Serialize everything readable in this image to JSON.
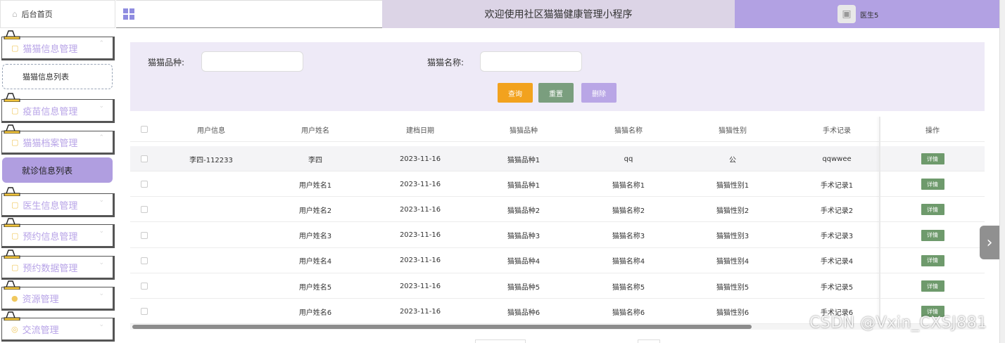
{
  "sidebar": {
    "home_label": "后台首页",
    "menus": [
      {
        "label": "猫猫信息管理"
      },
      {
        "label": "疫苗信息管理"
      },
      {
        "label": "猫猫档案管理"
      },
      {
        "label": "医生信息管理"
      },
      {
        "label": "预约信息管理"
      },
      {
        "label": "预约数据管理"
      },
      {
        "label": "资源管理"
      },
      {
        "label": "交流管理"
      }
    ],
    "sub_cat_list": "猫猫信息列表",
    "sub_active": "就诊信息列表"
  },
  "topbar": {
    "title": "欢迎使用社区猫猫健康管理小程序",
    "username": "医生5"
  },
  "search": {
    "breed_label": "猫猫品种:",
    "breed_value": "",
    "name_label": "猫猫名称:",
    "name_value": "",
    "query_button": "查询",
    "reset_button": "重置",
    "delete_button": "删除"
  },
  "table": {
    "headers": [
      "用户信息",
      "用户姓名",
      "建档日期",
      "猫猫品种",
      "猫猫名称",
      "猫猫性别",
      "手术记录",
      "操作"
    ],
    "detail_label": "详情",
    "rows": [
      [
        "李四-112233",
        "李四",
        "2023-11-16",
        "猫猫品种1",
        "qq",
        "公",
        "qqwwee"
      ],
      [
        "",
        "用户姓名1",
        "2023-11-16",
        "猫猫品种1",
        "猫猫名称1",
        "猫猫性别1",
        "手术记录1"
      ],
      [
        "",
        "用户姓名2",
        "2023-11-16",
        "猫猫品种2",
        "猫猫名称2",
        "猫猫性别2",
        "手术记录2"
      ],
      [
        "",
        "用户姓名3",
        "2023-11-16",
        "猫猫品种3",
        "猫猫名称3",
        "猫猫性别3",
        "手术记录3"
      ],
      [
        "",
        "用户姓名4",
        "2023-11-16",
        "猫猫品种4",
        "猫猫名称4",
        "猫猫性别4",
        "手术记录4"
      ],
      [
        "",
        "用户姓名5",
        "2023-11-16",
        "猫猫品种5",
        "猫猫名称5",
        "猫猫性别5",
        "手术记录5"
      ],
      [
        "",
        "用户姓名6",
        "2023-11-16",
        "猫猫品种6",
        "猫猫名称6",
        "猫猫性别6",
        "手术记录6"
      ]
    ]
  },
  "watermark": "CSDN @Vxin_CXSJ881",
  "colors": {
    "accent": "#b2a1e3",
    "query": "#f2a21e",
    "reset": "#7a9e7e",
    "delete": "#b9a6e6",
    "detail": "#6e9a6c"
  }
}
